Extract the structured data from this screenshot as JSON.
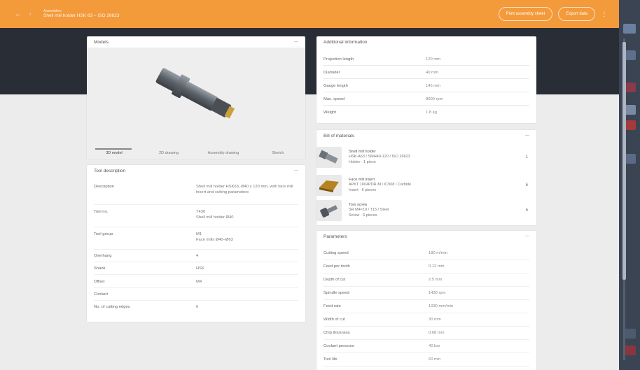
{
  "topbar": {
    "back_icon": "arrow-left-icon",
    "section_label": "Assemblies",
    "title": "Shell mill holder HSK 63 – ISO 26623",
    "actions": [
      {
        "label": "Print assembly sheet"
      },
      {
        "label": "Export data"
      }
    ],
    "menu_icon": "kebab-icon",
    "accent_color": "#f39a3b"
  },
  "models": {
    "title": "Models",
    "tabs": [
      {
        "label": "3D model",
        "active": true
      },
      {
        "label": "2D drawing",
        "active": false
      },
      {
        "label": "Assembly drawing",
        "active": false
      },
      {
        "label": "Sketch",
        "active": false
      }
    ]
  },
  "tool_description": {
    "title": "Tool description",
    "rows": [
      {
        "key": "Description",
        "value": "Shell mill holder HSK63, Ø40 x 120 mm, with face mill insert and cutting parameters"
      },
      {
        "key": "Tool no.",
        "value": "T430\nShell mill holder Ø40"
      },
      {
        "key": "Tool group",
        "value": "M1\nFace mills Ø40–Ø63"
      },
      {
        "key": "Overhang",
        "value": "4"
      },
      {
        "key": "Shank",
        "value": "HSK"
      },
      {
        "key": "Offset",
        "value": "M4"
      },
      {
        "key": "Coolant",
        "value": ""
      },
      {
        "key": "No. of cutting edges",
        "value": "6"
      }
    ]
  },
  "additional_info": {
    "title": "Additional information",
    "rows": [
      {
        "key": "Projection length",
        "value": "120 mm"
      },
      {
        "key": "Diameter",
        "value": "40 mm"
      },
      {
        "key": "Gauge length",
        "value": "145 mm"
      },
      {
        "key": "Max. speed",
        "value": "8000 rpm"
      },
      {
        "key": "Weight",
        "value": "1.8 kg"
      }
    ]
  },
  "bill_of_materials": {
    "title": "Bill of materials",
    "items": [
      {
        "name": "Shell mill holder",
        "line2": "HSK-A63 / SMH40-120 / ISO 26623",
        "line3": "Holder · 1 piece",
        "qty": "1"
      },
      {
        "name": "Face mill insert",
        "line2": "APKT 1604PDR-M / IC908 / Carbide",
        "line3": "Insert · 6 pieces",
        "qty": "6"
      },
      {
        "name": "Torx screw",
        "line2": "SR M4×10 / T15 / Steel",
        "line3": "Screw · 6 pieces",
        "qty": "6"
      }
    ]
  },
  "parameters": {
    "title": "Parameters",
    "rows": [
      {
        "key": "Cutting speed",
        "value": "180 m/min"
      },
      {
        "key": "Feed per tooth",
        "value": "0.12 mm"
      },
      {
        "key": "Depth of cut",
        "value": "2.5 mm"
      },
      {
        "key": "Spindle speed",
        "value": "1430 rpm"
      },
      {
        "key": "Feed rate",
        "value": "1030 mm/min"
      },
      {
        "key": "Width of cut",
        "value": "30 mm"
      },
      {
        "key": "Chip thickness",
        "value": "0.08 mm"
      },
      {
        "key": "Coolant pressure",
        "value": "40 bar"
      },
      {
        "key": "Tool life",
        "value": "60 min"
      }
    ]
  }
}
